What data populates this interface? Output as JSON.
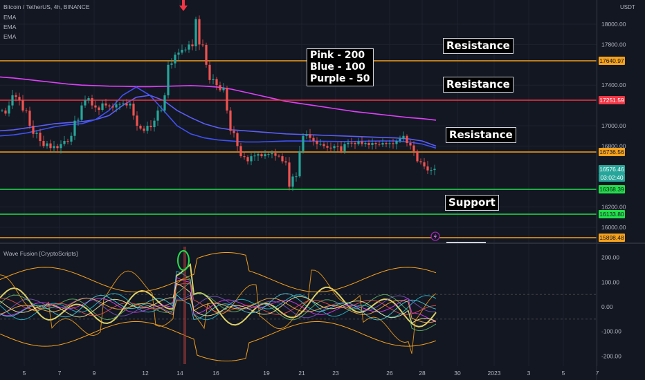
{
  "header": {
    "symbol_line": "Bitcoin / TetherUS, 4h, BINANCE",
    "indicators": [
      "EMA",
      "EMA",
      "EMA"
    ],
    "currency": "USDT"
  },
  "oscillator_title": "Wave Fusion [CryptoScripts]",
  "annotations": {
    "legend_text": "Pink - 200\nBlue - 100\nPurple - 50",
    "resistance_1": "Resistance",
    "resistance_2": "Resistance",
    "resistance_3": "Resistance",
    "support": "Support"
  },
  "colors": {
    "background": "#131722",
    "up_candle": "#26a69a",
    "down_candle": "#ef5350",
    "orange_level": "#f7a21b",
    "red_level": "#f23645",
    "green_level": "#22e04a",
    "ema_pink": "#e040fb",
    "ema_blue": "#5b5ef7"
  },
  "chart_data": {
    "type": "candlestick",
    "price_axis": {
      "ticks": [
        "18000.00",
        "17800.00",
        "17400.00",
        "17000.00",
        "16800.00",
        "16200.00",
        "16000.00"
      ],
      "tick_values": [
        18000,
        17800,
        17400,
        17000,
        16800,
        16200,
        16000
      ],
      "range": [
        15840,
        18200
      ]
    },
    "date_axis": {
      "ticks": [
        "5",
        "7",
        "9",
        "12",
        "14",
        "16",
        "19",
        "21",
        "23",
        "26",
        "28",
        "30",
        "2023",
        "3",
        "5",
        "7"
      ]
    },
    "price_labels": [
      {
        "text": "17640.97",
        "value": 17640.97,
        "color": "#f7a21b"
      },
      {
        "text": "17251.59",
        "value": 17251.59,
        "color": "#f23645"
      },
      {
        "text": "16736.56",
        "value": 16736.56,
        "color": "#f7a21b"
      },
      {
        "text": "16576.46",
        "value": 16576.46,
        "color": "#26a69a",
        "sub": "03:02:40"
      },
      {
        "text": "16368.39",
        "value": 16368.39,
        "color": "#22e04a"
      },
      {
        "text": "16133.80",
        "value": 16133.8,
        "color": "#22e04a"
      },
      {
        "text": "15898.48",
        "value": 15898.48,
        "color": "#f7a21b"
      }
    ],
    "horizontal_levels": [
      {
        "value": 17640.97,
        "color": "#f7a21b"
      },
      {
        "value": 17251.59,
        "color": "#f23645"
      },
      {
        "value": 16736.56,
        "color": "#f7a21b"
      },
      {
        "value": 16368.39,
        "color": "#22e04a"
      },
      {
        "value": 16133.8,
        "color": "#22e04a"
      },
      {
        "value": 15898.48,
        "color": "#f7a21b"
      }
    ],
    "price_path_approx": [
      17150,
      17200,
      17300,
      17250,
      17150,
      17000,
      16920,
      16850,
      16800,
      16780,
      16800,
      16820,
      16850,
      16900,
      17050,
      17200,
      17250,
      17200,
      17180,
      17220,
      17200,
      17180,
      17210,
      17220,
      17200,
      17100,
      17000,
      16950,
      17000,
      17050,
      17150,
      17300,
      17600,
      17700,
      17720,
      17750,
      17800,
      18050,
      17800,
      17600,
      17450,
      17400,
      17350,
      17150,
      16950,
      16800,
      16700,
      16650,
      16700,
      16720,
      16700,
      16720,
      16730,
      16700,
      16650,
      16400,
      16500,
      16750,
      16900,
      16880,
      16850,
      16820,
      16800,
      16780,
      16800,
      16750,
      16820,
      16830,
      16820,
      16820,
      16830,
      16830,
      16820,
      16830,
      16820,
      16820,
      16850,
      16900,
      16830,
      16750,
      16650,
      16600,
      16560,
      16576
    ],
    "ema_200": [
      17480,
      17470,
      17455,
      17440,
      17425,
      17410,
      17400,
      17395,
      17390,
      17388,
      17385,
      17385,
      17388,
      17392,
      17395,
      17390,
      17380,
      17360,
      17330,
      17300,
      17270,
      17240,
      17220,
      17200,
      17180,
      17160,
      17140,
      17125,
      17110,
      17095,
      17080,
      17070,
      17055
    ],
    "ema_100": [
      16950,
      16960,
      16980,
      17000,
      17020,
      17030,
      17040,
      17060,
      17100,
      17200,
      17280,
      17300,
      17250,
      17150,
      17080,
      17020,
      16980,
      16960,
      16950,
      16940,
      16930,
      16920,
      16915,
      16910,
      16905,
      16900,
      16895,
      16890,
      16885,
      16880,
      16870,
      16850,
      16800
    ],
    "ema_50": [
      16900,
      16910,
      16930,
      16960,
      16990,
      17010,
      17020,
      17060,
      17150,
      17300,
      17380,
      17300,
      17150,
      17000,
      16920,
      16880,
      16860,
      16850,
      16840,
      16840,
      16845,
      16850,
      16850,
      16848,
      16846,
      16845,
      16845,
      16848,
      16850,
      16850,
      16840,
      16820,
      16780
    ],
    "oscillator": {
      "ticks": [
        "200.00",
        "100.00",
        "0.00",
        "-100.00",
        "-200.00"
      ],
      "tick_values": [
        200,
        100,
        0,
        -100,
        -200
      ],
      "range": [
        -230,
        230
      ]
    }
  }
}
